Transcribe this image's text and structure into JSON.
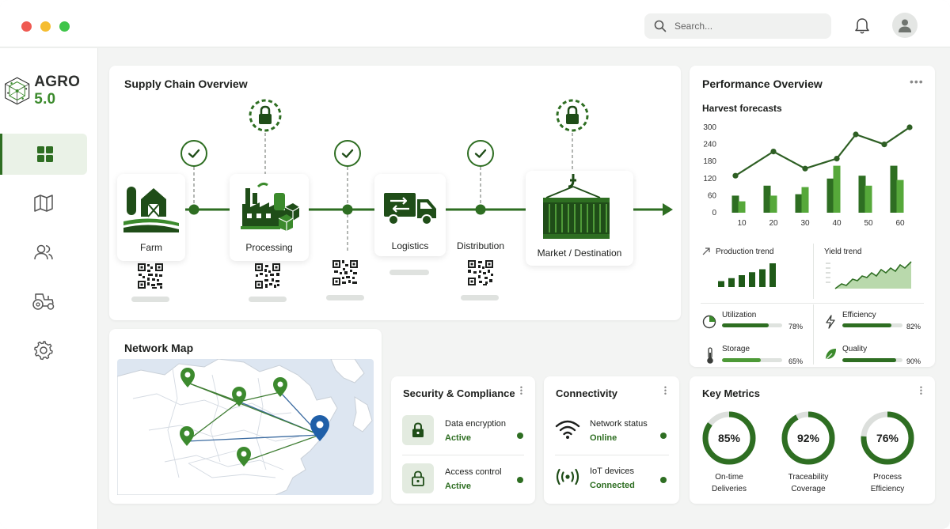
{
  "header": {
    "search_placeholder": "Search...",
    "window_controls": {
      "close_color": "#ef5a52",
      "minimize_color": "#f5bd31",
      "maximize_color": "#3fc54a"
    }
  },
  "brand": {
    "name": "AGRO",
    "version": "5.0",
    "accent": "#2e6e22"
  },
  "sidebar": {
    "items": [
      {
        "id": "dashboard",
        "icon": "grid-icon",
        "active": true
      },
      {
        "id": "map",
        "icon": "map-icon",
        "active": false
      },
      {
        "id": "users",
        "icon": "users-icon",
        "active": false
      },
      {
        "id": "tractor",
        "icon": "tractor-icon",
        "active": false
      },
      {
        "id": "settings",
        "icon": "gear-icon",
        "active": false
      }
    ]
  },
  "supply_chain": {
    "title": "Supply Chain Overview",
    "stages": [
      {
        "label": "Farm",
        "icon": "barn-icon"
      },
      {
        "label": "Processing",
        "icon": "factory-icon"
      },
      {
        "label": "Logistics",
        "icon": "truck-icon"
      },
      {
        "label": "Distribution",
        "icon": ""
      },
      {
        "label": "Market / Destination",
        "icon": "container-icon"
      }
    ]
  },
  "network_map": {
    "title": "Network Map"
  },
  "performance": {
    "title": "Performance Overview",
    "harvest_title": "Harvest forecasts",
    "chart_data": {
      "type": "bar",
      "title": "Harvest forecasts",
      "y_ticks": [
        0,
        60,
        120,
        180,
        240,
        300
      ],
      "x_ticks": [
        10,
        20,
        30,
        40,
        50,
        60
      ],
      "ylim": [
        0,
        300
      ],
      "xlim": [
        5,
        65
      ],
      "bars_dark": [
        {
          "x": 8,
          "y": 60
        },
        {
          "x": 18,
          "y": 95
        },
        {
          "x": 28,
          "y": 65
        },
        {
          "x": 38,
          "y": 120
        },
        {
          "x": 48,
          "y": 130
        },
        {
          "x": 58,
          "y": 165
        }
      ],
      "bars_light": [
        {
          "x": 10,
          "y": 40
        },
        {
          "x": 20,
          "y": 60
        },
        {
          "x": 30,
          "y": 90
        },
        {
          "x": 40,
          "y": 165
        },
        {
          "x": 50,
          "y": 95
        },
        {
          "x": 60,
          "y": 115
        }
      ],
      "line": [
        {
          "x": 8,
          "y": 130
        },
        {
          "x": 20,
          "y": 215
        },
        {
          "x": 30,
          "y": 155
        },
        {
          "x": 40,
          "y": 190
        },
        {
          "x": 46,
          "y": 275
        },
        {
          "x": 55,
          "y": 240
        },
        {
          "x": 63,
          "y": 300
        }
      ],
      "colors": {
        "dark": "#2e6e22",
        "light": "#56a83a",
        "line": "#2e5f24"
      }
    },
    "production_trend": {
      "label": "Production trend",
      "values": [
        2,
        3,
        4,
        5,
        6,
        8
      ]
    },
    "yield_trend": {
      "label": "Yield trend"
    },
    "metrics": [
      {
        "label": "Utilization",
        "value": "78%",
        "fraction": 0.78,
        "icon": "pie-icon",
        "color": "#2e6e22"
      },
      {
        "label": "Efficiency",
        "value": "82%",
        "fraction": 0.82,
        "icon": "bolt-icon",
        "color": "#2e6e22"
      },
      {
        "label": "Storage",
        "value": "65%",
        "fraction": 0.65,
        "icon": "thermometer-icon",
        "color": "#4d9a37"
      },
      {
        "label": "Quality",
        "value": "90%",
        "fraction": 0.9,
        "icon": "leaf-icon",
        "color": "#2e6e22"
      }
    ]
  },
  "security": {
    "title": "Security & Compliance",
    "rows": [
      {
        "title": "Data encryption",
        "status": "Active"
      },
      {
        "title": "Access control",
        "status": "Active"
      }
    ]
  },
  "connectivity": {
    "title": "Connectivity",
    "rows": [
      {
        "title": "Network status",
        "status": "Online"
      },
      {
        "title": "IoT devices",
        "status": "Connected"
      }
    ]
  },
  "key_metrics": {
    "title": "Key Metrics",
    "gauges": [
      {
        "value": "85%",
        "fraction": 0.85,
        "label_line1": "On-time",
        "label_line2": "Deliveries"
      },
      {
        "value": "92%",
        "fraction": 0.92,
        "label_line1": "Traceability",
        "label_line2": "Coverage"
      },
      {
        "value": "76%",
        "fraction": 0.76,
        "label_line1": "Process",
        "label_line2": "Efficiency"
      }
    ]
  }
}
